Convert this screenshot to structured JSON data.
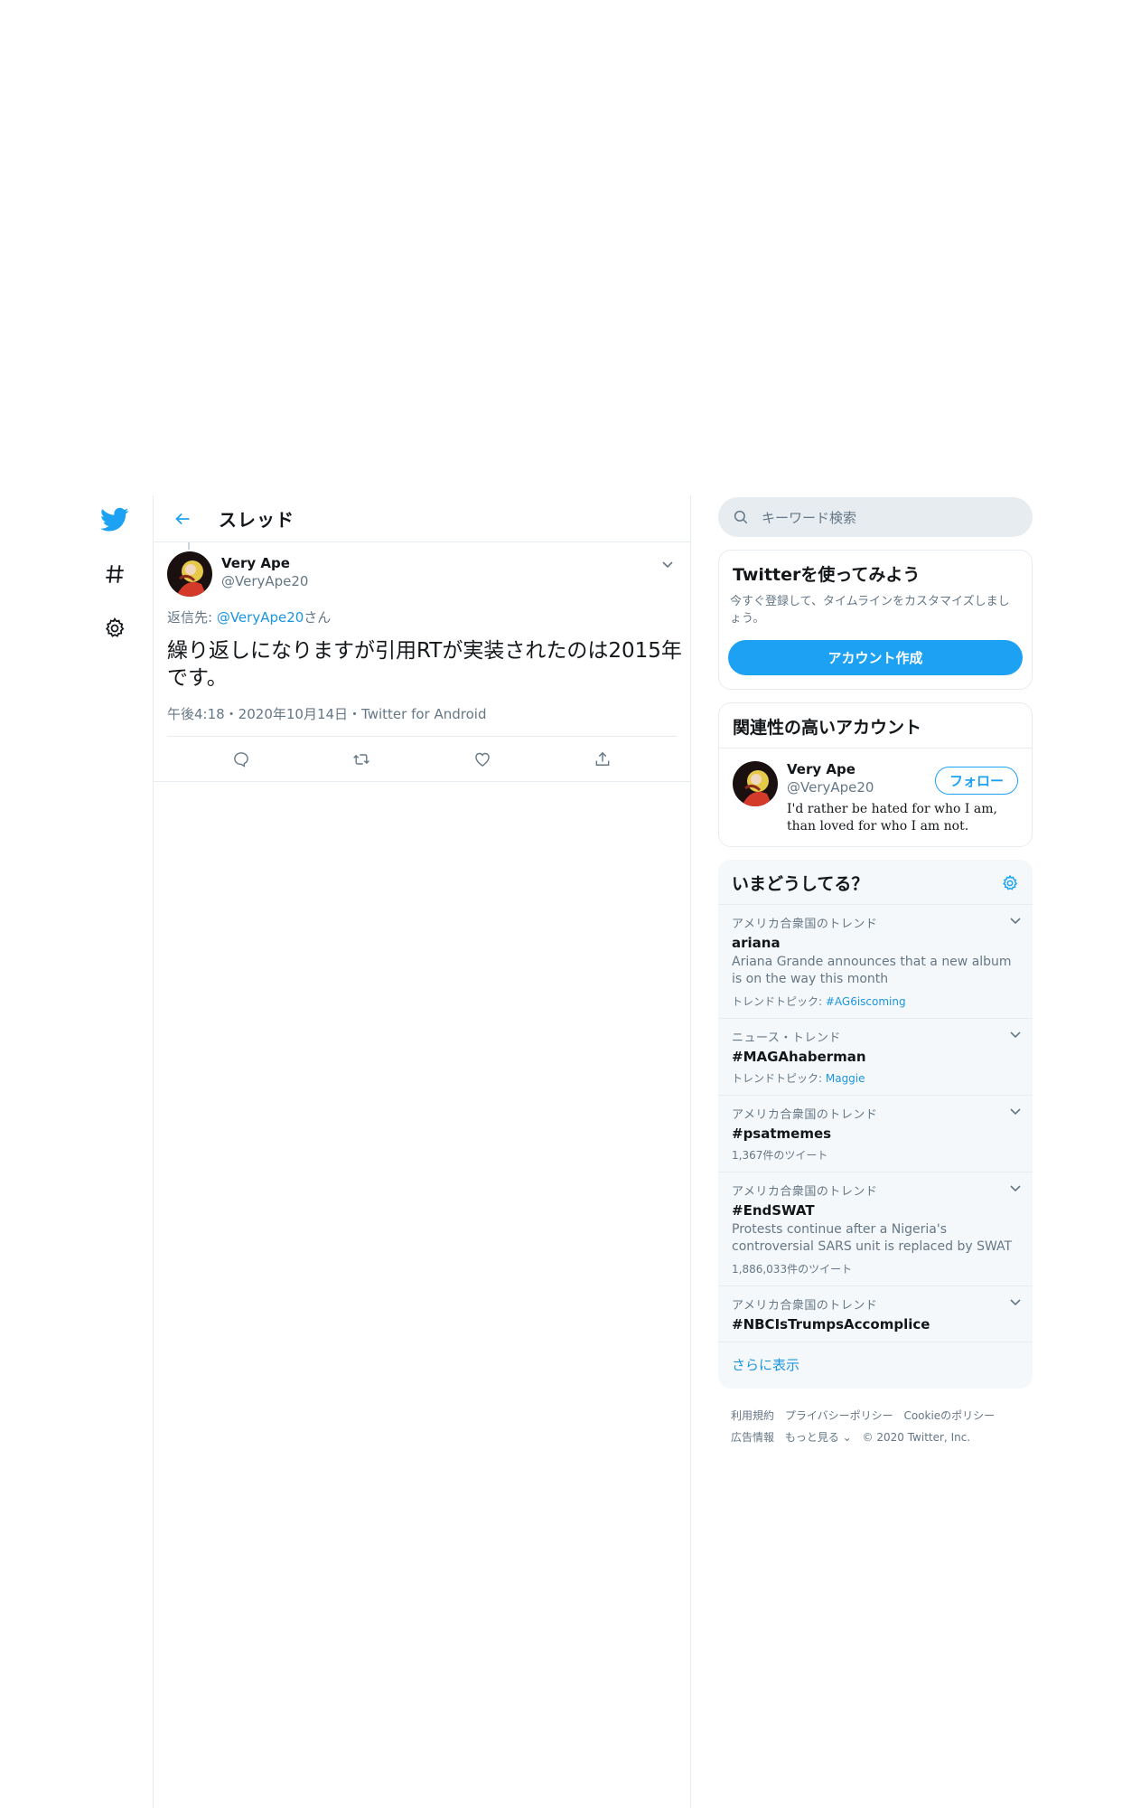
{
  "nav": {
    "icons": [
      "twitter-bird-icon",
      "hashtag-icon",
      "gear-icon"
    ]
  },
  "header": {
    "title": "スレッド"
  },
  "tweet": {
    "display_name": "Very Ape",
    "screen_name": "@VeryApe20",
    "replying_prefix": "返信先: ",
    "replying_mention": "@VeryApe20",
    "replying_suffix": "さん",
    "text": "繰り返しになりますが引用RTが実装されたのは2015年です。",
    "meta": "午後4:18・2020年10月14日・Twitter for Android"
  },
  "search": {
    "placeholder": "キーワード検索"
  },
  "signup": {
    "title": "Twitterを使ってみよう",
    "subtitle": "今すぐ登録して、タイムラインをカスタマイズしましょう。",
    "button": "アカウント作成"
  },
  "related": {
    "title": "関連性の高いアカウント",
    "name": "Very Ape",
    "handle": "@VeryApe20",
    "bio": "I'd rather be hated for who I am, than loved for who I am not.",
    "follow": "フォロー"
  },
  "trends": {
    "title": "いまどうしてる？",
    "items": [
      {
        "context": "アメリカ合衆国のトレンド",
        "name": "ariana",
        "desc": "Ariana Grande announces that a new album is on the way this month",
        "topic_label": "トレンドトピック: ",
        "topic_link": "#AG6iscoming"
      },
      {
        "context": "ニュース・トレンド",
        "name": "#MAGAhaberman",
        "topic_label": "トレンドトピック: ",
        "topic_link": "Maggie"
      },
      {
        "context": "アメリカ合衆国のトレンド",
        "name": "#psatmemes",
        "count": "1,367件のツイート"
      },
      {
        "context": "アメリカ合衆国のトレンド",
        "name": "#EndSWAT",
        "desc": "Protests continue after a Nigeria's controversial SARS unit is replaced by SWAT",
        "count": "1,886,033件のツイート"
      },
      {
        "context": "アメリカ合衆国のトレンド",
        "name": "#NBCIsTrumpsAccomplice"
      }
    ],
    "more": "さらに表示"
  },
  "footer": {
    "links": [
      "利用規約",
      "プライバシーポリシー",
      "Cookieのポリシー",
      "広告情報",
      "もっと見る ⌄",
      "© 2020 Twitter, Inc."
    ]
  },
  "colors": {
    "accent": "#1da1f2",
    "link": "#1b95e0",
    "muted": "#657786",
    "border": "#e6ecf0"
  }
}
